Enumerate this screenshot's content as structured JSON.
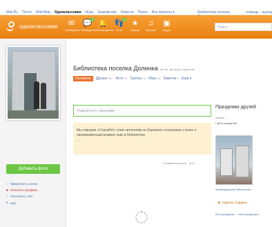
{
  "topbar": {
    "links": [
      "Mail.Ru",
      "Почта",
      "Мой Мир",
      "Одноклассники",
      "Игры",
      "Знакомства",
      "Новости",
      "Поиск",
      "Все проекты ▾"
    ],
    "right_links": [
      "Библиотека поселка Долинка",
      "помощь",
      "выход"
    ]
  },
  "nav": {
    "logo_text": "одноклассники",
    "items": [
      {
        "label": "Сообщения",
        "icon": "envelope-icon",
        "glyph": "✉",
        "badge": ""
      },
      {
        "label": "Обсуждения",
        "icon": "chat-icon",
        "glyph": "💬",
        "badge": "2"
      },
      {
        "label": "Оповещения",
        "icon": "bell-icon",
        "glyph": "🔔",
        "badge": ""
      },
      {
        "label": "Гости",
        "icon": "footprints-icon",
        "glyph": "👣",
        "badge": "2"
      },
      {
        "label": "Оценки",
        "icon": "star-icon",
        "glyph": "★",
        "badge": ""
      },
      {
        "label": "Музыка",
        "icon": "music-icon",
        "glyph": "♫",
        "badge": ""
      },
      {
        "label": "Видео",
        "icon": "video-icon",
        "glyph": "▣",
        "badge": ""
      }
    ],
    "search_placeholder": "Поиск"
  },
  "left": {
    "add_photo": "Добавить фото",
    "links": [
      "Прикрепить значок",
      "Оплатить профиль",
      "Пополнить счёт",
      "ещё"
    ]
  },
  "main": {
    "title": "Библиотека поселка Долинка",
    "place": "45 лет, Долинка, Казахстан",
    "tabs": [
      {
        "label": "Основное",
        "count": "",
        "selected": true
      },
      {
        "label": "Друзья",
        "count": "267",
        "selected": false
      },
      {
        "label": "Фото",
        "count": "21",
        "selected": false
      },
      {
        "label": "Группы",
        "count": "18",
        "selected": false
      },
      {
        "label": "Игры",
        "count": "11",
        "selected": false
      },
      {
        "label": "Заметки",
        "count": "1",
        "selected": false
      },
      {
        "label": "Ещё ▾",
        "count": "",
        "selected": false
      }
    ],
    "post_placeholder": "Поделиться с друзьями",
    "status_text": "Мы говорим «Спасибо!» этим читателям за бережное отношение к книге и своевременный возврат книг в библиотеку",
    "status_more": "...",
    "comments": "0 Комментировать",
    "likes": "12"
  },
  "right": {
    "title": "Праздники друзей",
    "subtitle": "Завтра",
    "birthday": "День рождения",
    "friend_name": "Залинодовская библиотека",
    "gift": "Сделать подарок",
    "footer": [
      "Все праздники ›",
      "Мои праздники ›"
    ]
  }
}
